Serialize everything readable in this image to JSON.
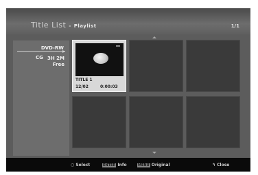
{
  "header": {
    "title": "Title List",
    "separator": "-",
    "subtitle": "Playlist",
    "page_counter": "1/1"
  },
  "sidebar": {
    "disc_type": "DVD-RW",
    "disc_icon": "CG",
    "time_remaining": "3H 2M",
    "free_label": "Free"
  },
  "items": [
    {
      "title": "TITLE 1",
      "date": "12/02",
      "length": "0:00:03",
      "selected": true
    }
  ],
  "footer": {
    "select_hint": "Select",
    "enter_key": "ENTER",
    "info_hint": "Info",
    "menu_key": "MENU",
    "original_hint": "Original",
    "close_hint": "Close"
  }
}
